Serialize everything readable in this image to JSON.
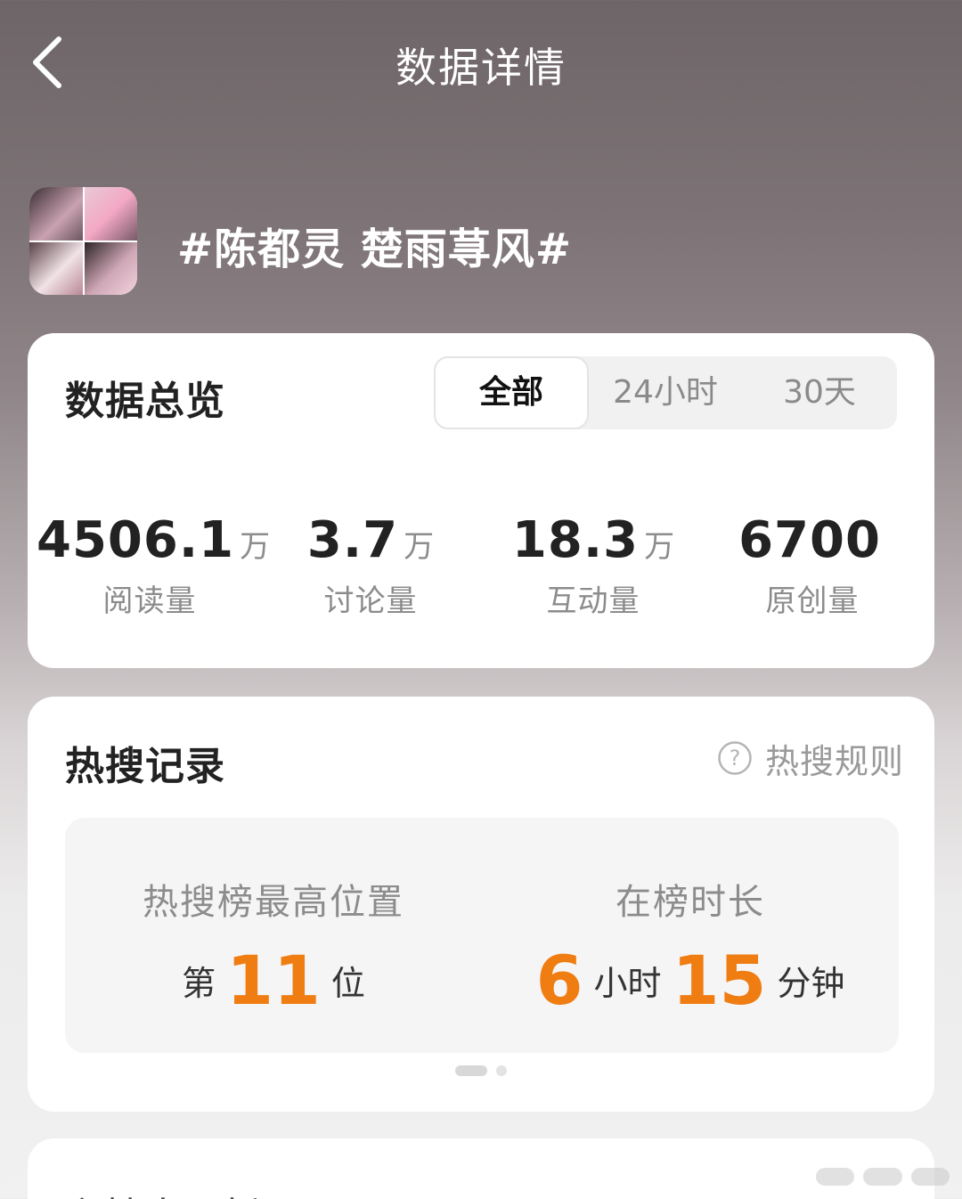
{
  "header": {
    "title": "数据详情"
  },
  "topic": {
    "title": "#陈都灵 楚雨荨风#"
  },
  "overview": {
    "title": "数据总览",
    "tabs": [
      {
        "label": "全部",
        "active": true
      },
      {
        "label": "24小时",
        "active": false
      },
      {
        "label": "30天",
        "active": false
      }
    ],
    "stats": [
      {
        "value": "4506.1",
        "unit": "万",
        "label": "阅读量"
      },
      {
        "value": "3.7",
        "unit": "万",
        "label": "讨论量"
      },
      {
        "value": "18.3",
        "unit": "万",
        "label": "互动量"
      },
      {
        "value": "6700",
        "unit": "",
        "label": "原创量"
      }
    ]
  },
  "hot_search": {
    "title": "热搜记录",
    "rules_label": "热搜规则",
    "highest_rank": {
      "label": "热搜榜最高位置",
      "prefix": "第",
      "number": "11",
      "suffix": "位"
    },
    "duration": {
      "label": "在榜时长",
      "hours": "6",
      "hours_unit": "小时",
      "minutes": "15",
      "minutes_unit": "分钟"
    }
  },
  "next_card": {
    "text": "主持人　新天"
  },
  "colors": {
    "accent": "#f07d12",
    "card_bg": "#ffffff",
    "muted_text": "#8c8c8c"
  }
}
